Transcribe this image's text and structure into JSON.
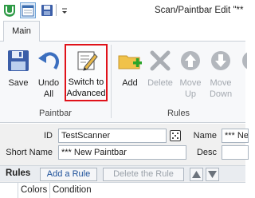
{
  "titlebar": {
    "title": "Scan/Paintbar Edit \"**",
    "quick_access": [
      "app-icon",
      "calendar-edit-icon",
      "save-icon",
      "dropdown-icon"
    ]
  },
  "tabs": [
    {
      "label": "Main",
      "selected": true
    }
  ],
  "ribbon": {
    "groups": [
      {
        "label": "Paintbar"
      },
      {
        "label": "Rules"
      }
    ],
    "buttons": {
      "save": {
        "label": "Save",
        "icon": "floppy-disk-icon"
      },
      "undo_all": {
        "label": "Undo\nAll",
        "icon": "undo-icon"
      },
      "switch_advanced": {
        "label": "Switch to\nAdvanced",
        "icon": "edit-document-icon",
        "highlighted": true
      },
      "add": {
        "label": "Add",
        "icon": "folder-add-icon"
      },
      "delete": {
        "label": "Delete",
        "icon": "delete-x-icon",
        "disabled": true
      },
      "move_up": {
        "label": "Move\nUp",
        "icon": "arrow-up-icon",
        "disabled": true
      },
      "move_down": {
        "label": "Move\nDown",
        "icon": "arrow-down-icon",
        "disabled": true
      }
    }
  },
  "form": {
    "id_label": "ID",
    "id_value": "TestScanner",
    "name_label": "Name",
    "name_value": "*** Ne",
    "short_name_label": "Short Name",
    "short_name_value": "*** New Paintbar",
    "desc_label": "Desc",
    "desc_value": ""
  },
  "rules": {
    "title": "Rules",
    "add_rule": "Add a Rule",
    "delete_rule": "Delete the Rule",
    "columns": [
      "Colors",
      "Condition"
    ]
  },
  "colors": {
    "highlight_border": "#e0121a",
    "ribbon_bg": "#f7f8fa",
    "form_bg": "#f0f0f0",
    "save_blue": "#3b5ea8",
    "add_green": "#2aa52a",
    "folder_yellow": "#f0c24a"
  }
}
